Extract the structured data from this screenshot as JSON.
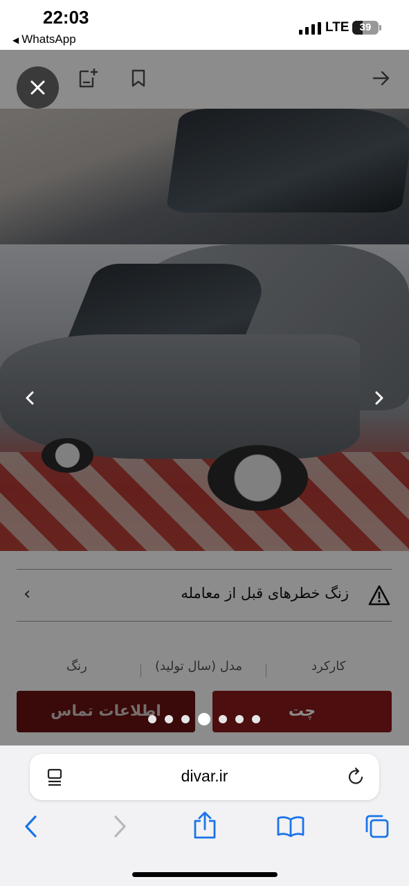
{
  "status_bar": {
    "time": "22:03",
    "back_app": "WhatsApp",
    "network": "LTE",
    "battery": "39",
    "battery_level": 0.39
  },
  "listing": {
    "warning_text": "زنگ خطرهای قبل از معامله",
    "specs": [
      "کارکرد",
      "مدل (سال تولید)",
      "رنگ"
    ],
    "chat_label": "چت",
    "contact_label": "اطلاعات تماس"
  },
  "gallery": {
    "dots_count": 7,
    "active_index": 3
  },
  "browser": {
    "url": "divar.ir"
  },
  "icons": {
    "close": "close-icon",
    "add_note": "add-note-icon",
    "bookmark": "bookmark-icon",
    "forward": "arrow-right-icon",
    "prev": "chevron-left-icon",
    "next": "chevron-right-icon",
    "warning": "warning-triangle-icon",
    "reader": "reader-mode-icon",
    "reload": "reload-icon",
    "share": "share-icon",
    "bookmarks": "book-icon",
    "tabs": "tabs-icon"
  },
  "colors": {
    "accent": "#8a1a1a",
    "safari_blue": "#1a73e8"
  }
}
